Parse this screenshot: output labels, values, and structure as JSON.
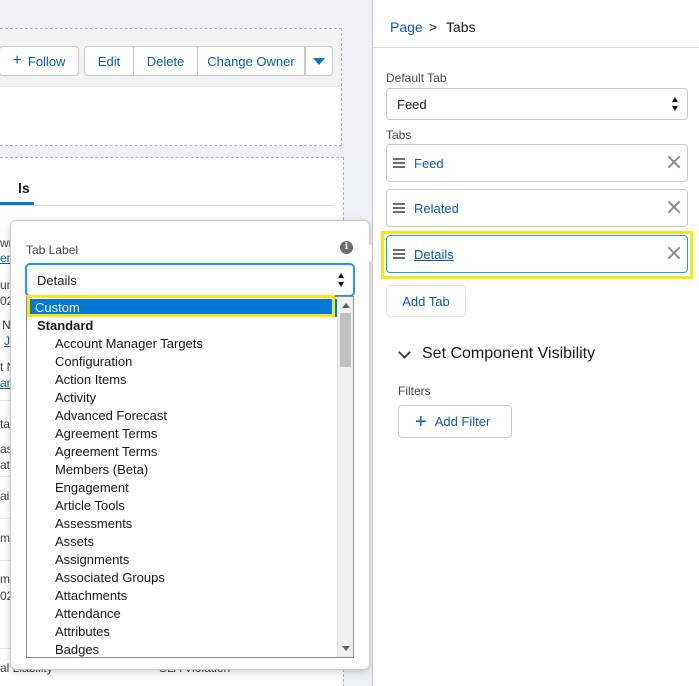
{
  "canvas": {
    "header_buttons": {
      "follow": "Follow",
      "edit": "Edit",
      "delete": "Delete",
      "change_owner": "Change Owner"
    },
    "tab_fragment": "ls",
    "field_fragments": [
      "wn",
      "en",
      "um",
      "02",
      "N",
      "J",
      "t Nam",
      "anos",
      "tal",
      "ason",
      "ation",
      "ail",
      "me",
      "me Op",
      "023",
      "al Liability",
      "SLA Violation"
    ]
  },
  "popover": {
    "tab_label_title": "Tab Label",
    "tab_label_value": "Details",
    "options": {
      "selected": "Custom",
      "group_label": "Standard",
      "items": [
        "Account Manager Targets",
        "Configuration",
        "Action Items",
        "Activity",
        "Advanced Forecast",
        "Agreement Terms",
        "Agreement Terms",
        "Members (Beta)",
        "Engagement",
        "Article Tools",
        "Assessments",
        "Assets",
        "Assignments",
        "Associated Groups",
        "Attachments",
        "Attendance",
        "Attributes",
        "Badges"
      ]
    }
  },
  "panel": {
    "breadcrumb": {
      "page": "Page",
      "separator": ">",
      "current": "Tabs"
    },
    "default_tab_label": "Default Tab",
    "default_tab_value": "Feed",
    "tabs_label": "Tabs",
    "tabs": [
      "Feed",
      "Related",
      "Details"
    ],
    "add_tab": "Add Tab",
    "visibility_title": "Set Component Visibility",
    "filters_label": "Filters",
    "add_filter": "Add Filter"
  },
  "colors": {
    "accent": "#0176d3",
    "link": "#0b5cab",
    "highlight": "#f5e813",
    "selected_option": "#0078d7"
  }
}
